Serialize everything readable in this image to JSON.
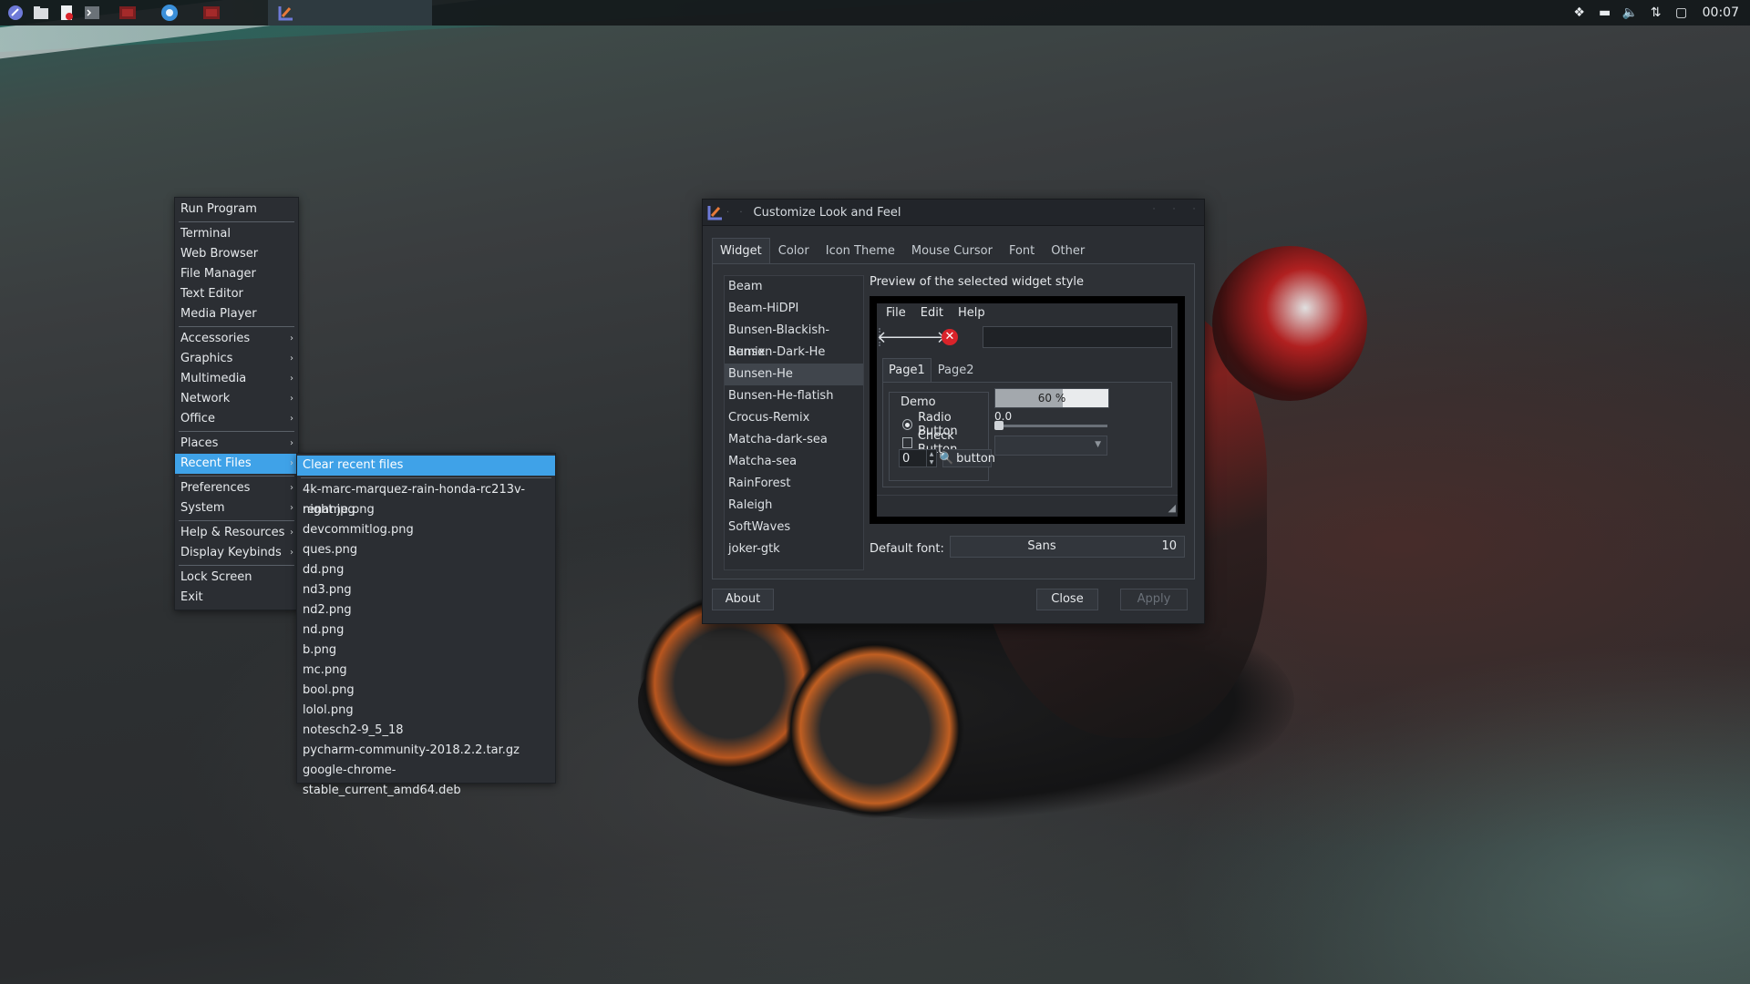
{
  "panel": {
    "launchers": [
      "app-menu-icon",
      "file-manager-icon",
      "document-icon",
      "terminal-icon",
      "app-icon",
      "browser-icon",
      "app-icon"
    ],
    "clock": "00:07"
  },
  "menu": {
    "items": [
      {
        "label": "Run Program"
      },
      {
        "label": "Terminal"
      },
      {
        "label": "Web Browser"
      },
      {
        "label": "File Manager"
      },
      {
        "label": "Text Editor"
      },
      {
        "label": "Media Player"
      },
      {
        "label": "Accessories"
      },
      {
        "label": "Graphics"
      },
      {
        "label": "Multimedia"
      },
      {
        "label": "Network"
      },
      {
        "label": "Office"
      },
      {
        "label": "Places"
      },
      {
        "label": "Recent Files"
      },
      {
        "label": "Preferences"
      },
      {
        "label": "System"
      },
      {
        "label": "Help & Resources"
      },
      {
        "label": "Display Keybinds"
      },
      {
        "label": "Lock Screen"
      },
      {
        "label": "Exit"
      }
    ]
  },
  "recent": {
    "clear": "Clear recent files",
    "files": [
      "4k-marc-marquez-rain-honda-rc213v-night.jpg",
      "rename.png",
      "devcommitlog.png",
      "ques.png",
      "dd.png",
      "nd3.png",
      "nd2.png",
      "nd.png",
      "b.png",
      "mc.png",
      "bool.png",
      "lolol.png",
      "notesch2-9_5_18",
      "pycharm-community-2018.2.2.tar.gz",
      "google-chrome-stable_current_amd64.deb"
    ]
  },
  "dialog": {
    "title": "Customize Look and Feel",
    "tabs": [
      "Widget",
      "Color",
      "Icon Theme",
      "Mouse Cursor",
      "Font",
      "Other"
    ],
    "themes": [
      "Beam",
      "Beam-HiDPI",
      "Bunsen-Blackish-Remix",
      "Bunsen-Dark-He",
      "Bunsen-He",
      "Bunsen-He-flatish",
      "Crocus-Remix",
      "Matcha-dark-sea",
      "Matcha-sea",
      "RainForest",
      "Raleigh",
      "SoftWaves",
      "joker-gtk"
    ],
    "selected_theme": "Bunsen-He",
    "preview_label": "Preview of the selected widget style",
    "preview": {
      "menus": [
        "File",
        "Edit",
        "Help"
      ],
      "tabs": [
        "Page1",
        "Page2"
      ],
      "frame_label": "Demo",
      "radio_label": "Radio Button",
      "check_label": "Check Button",
      "spin_value": "0",
      "button_label": "button",
      "progress_text": "60 %",
      "progress_fraction": 0.6,
      "scale_value": "0.0"
    },
    "default_font_label": "Default font:",
    "font_name": "Sans",
    "font_size": "10",
    "about": "About",
    "close": "Close",
    "apply": "Apply"
  }
}
